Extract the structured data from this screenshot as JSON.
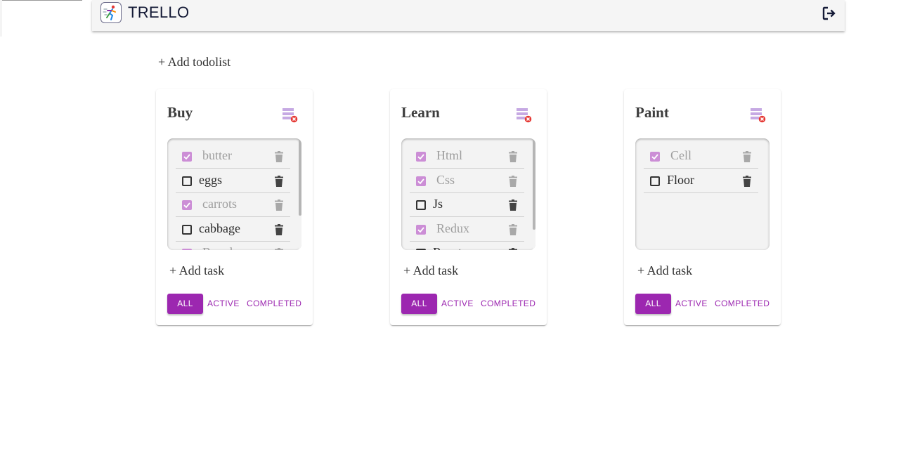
{
  "app": {
    "title": "TRELLO",
    "logo_icon": "running-figure-logo-icon",
    "logout_icon": "logout-icon"
  },
  "add_todolist_label": "+ Add todolist",
  "colors": {
    "accent": "#9c27b0",
    "checked": "#cc8ed6",
    "delete_red": "#e53935"
  },
  "todolists": [
    {
      "title": "Buy",
      "tasks": [
        {
          "label": "butter",
          "done": true
        },
        {
          "label": "eggs",
          "done": false
        },
        {
          "label": "carrots",
          "done": true
        },
        {
          "label": "cabbage",
          "done": false
        },
        {
          "label": "Bread",
          "done": true
        }
      ],
      "add_task_label": "+ Add task",
      "filters": [
        "ALL",
        "ACTIVE",
        "COMPLETED"
      ],
      "active_filter": "ALL"
    },
    {
      "title": "Learn",
      "tasks": [
        {
          "label": "Html",
          "done": true
        },
        {
          "label": "Css",
          "done": true
        },
        {
          "label": "Js",
          "done": false
        },
        {
          "label": "Redux",
          "done": true
        },
        {
          "label": "React",
          "done": false
        }
      ],
      "add_task_label": "+ Add task",
      "filters": [
        "ALL",
        "ACTIVE",
        "COMPLETED"
      ],
      "active_filter": "ALL"
    },
    {
      "title": "Paint",
      "tasks": [
        {
          "label": "Cell",
          "done": true
        },
        {
          "label": "Floor",
          "done": false
        }
      ],
      "add_task_label": "+ Add task",
      "filters": [
        "ALL",
        "ACTIVE",
        "COMPLETED"
      ],
      "active_filter": "ALL"
    }
  ]
}
